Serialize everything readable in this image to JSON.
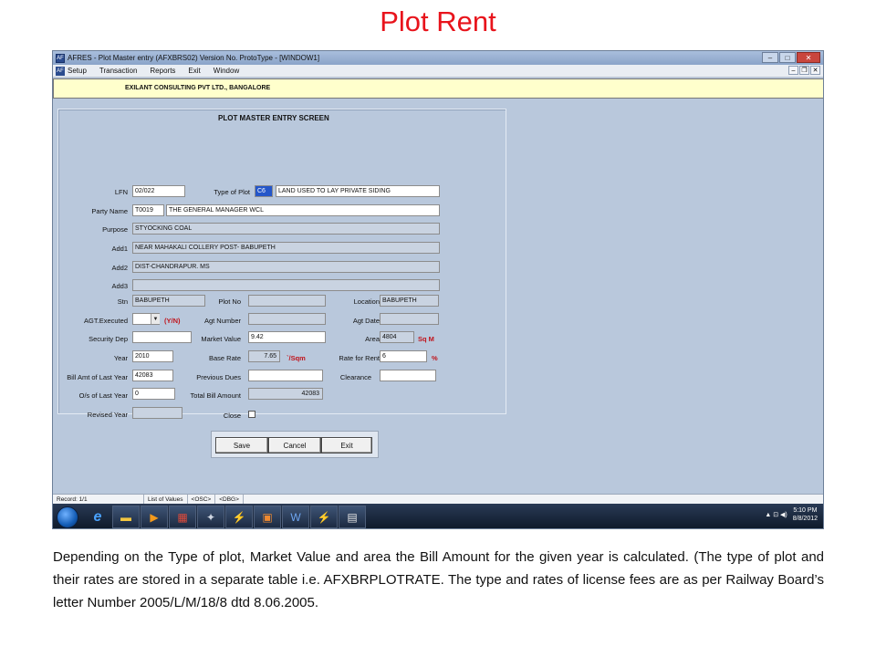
{
  "slide_title": "Plot Rent",
  "window": {
    "title": "AFRES - Plot Master entry (AFXBRS02) Version No. ProtoType - [WINDOW1]",
    "app_icon": "AF",
    "title_buttons": {
      "min": "–",
      "max": "□",
      "close": "✕"
    },
    "menu": [
      "Setup",
      "Transaction",
      "Reports",
      "Exit",
      "Window"
    ],
    "menu_buttons": {
      "min": "–",
      "restore": "❐",
      "close": "✕"
    }
  },
  "banner": "EXILANT CONSULTING PVT LTD., BANGALORE",
  "form": {
    "title": "PLOT MASTER ENTRY SCREEN",
    "labels": {
      "lfn": "LFN",
      "type_of_plot": "Type of Plot",
      "party_name": "Party Name",
      "purpose": "Purpose",
      "add1": "Add1",
      "add2": "Add2",
      "add3": "Add3",
      "stn": "Stn",
      "plot_no": "Plot No",
      "location": "Location",
      "agt_executed": "AGT.Executed",
      "agt_number": "Agt Number",
      "agt_date": "Agt Date",
      "security_dep": "Security Dep",
      "market_value": "Market Value",
      "area": "Area",
      "year": "Year",
      "base_rate": "Base Rate",
      "rate_for_rent": "Rate for Rent",
      "bill_amt_last_year": "Bill Amt of Last Year",
      "previous_dues": "Previous Dues",
      "clearance": "Clearance",
      "os_last_year": "O/s of Last Year",
      "total_bill_amount": "Total Bill Amount",
      "revised_year": "Revised Year",
      "close": "Close"
    },
    "values": {
      "lfn": "02/022",
      "type_code": "C6",
      "type_desc": "LAND USED TO LAY PRIVATE SIDING",
      "party_code": "T0019",
      "party_name": "THE GENERAL MANAGER WCL",
      "purpose": "STYOCKING COAL",
      "add1": "NEAR MAHAKALI COLLERY POST- BABUPETH",
      "add2": "DIST-CHANDRAPUR. MS",
      "add3": "",
      "stn": "BABUPETH",
      "plot_no": "",
      "location": "BABUPETH",
      "agt_executed": "",
      "agt_number": "",
      "agt_date": "",
      "security_dep": "",
      "market_value": "9.42",
      "area": "4804",
      "year": "2010",
      "base_rate": "7.65",
      "rate_for_rent": "6",
      "bill_amt_last_year": "42083",
      "previous_dues": "",
      "clearance": "",
      "os_last_year": "0",
      "total_bill_amount": "42083",
      "revised_year": ""
    },
    "units": {
      "yn": "(Y/N)",
      "sqm": "Sq M",
      "per_sqm": "`/Sqm",
      "percent": "%"
    },
    "buttons": {
      "save": "Save",
      "cancel": "Cancel",
      "exit": "Exit"
    }
  },
  "statusbar": [
    "Record: 1/1",
    "List of Values",
    "<OSC>",
    "<DBG>"
  ],
  "taskbar": {
    "clock_time": "5:10 PM",
    "clock_date": "8/8/2012",
    "tray": "▲ ⊡ ◀)"
  },
  "description": "Depending on the Type of plot, Market Value and area the Bill Amount for the given year is calculated. (The type of plot and their rates are stored in a separate table i.e. AFXBRPLOTRATE. The type and rates of license fees are as per Railway Board’s letter Number 2005/L/M/18/8 dtd 8.06.2005."
}
